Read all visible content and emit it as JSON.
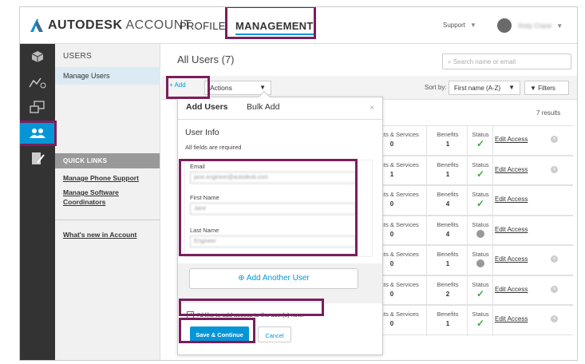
{
  "header": {
    "brand": "AUTODESK",
    "brand_suffix": "ACCOUNT",
    "nav_profile": "PROFILE",
    "nav_management": "MANAGEMENT",
    "support": "Support",
    "user_name": "Andy Crane"
  },
  "subnav": {
    "heading": "USERS",
    "manage_users": "Manage Users",
    "quick_links": "QUICK LINKS",
    "phone_support": "Manage Phone Support",
    "software_coordinators": "Manage Software Coordinators",
    "whats_new": "What's new in Account"
  },
  "main": {
    "title": "All Users (7)",
    "search_placeholder": "Search name or email",
    "add": "+ Add",
    "actions": "Actions",
    "sort_label": "Sort by:",
    "sort_value": "First name (A-Z)",
    "filters": "Filters",
    "results": "7 results"
  },
  "table": {
    "rows": [
      {
        "products_label": "Products & Services",
        "products": "0",
        "benefits_label": "Benefits",
        "benefits": "1",
        "status_label": "Status",
        "status": "active",
        "edit": "Edit Access",
        "removable": true
      },
      {
        "products_label": "Products & Services",
        "products": "1",
        "benefits_label": "Benefits",
        "benefits": "1",
        "status_label": "Status",
        "status": "active",
        "edit": "Edit Access",
        "removable": true
      },
      {
        "products_label": "Products & Services",
        "products": "0",
        "benefits_label": "Benefits",
        "benefits": "4",
        "status_label": "Status",
        "status": "active",
        "edit": "Edit Access",
        "removable": false
      },
      {
        "products_label": "Products & Services",
        "products": "0",
        "benefits_label": "Benefits",
        "benefits": "4",
        "status_label": "Status",
        "status": "pending",
        "edit": "Edit Access",
        "removable": false
      },
      {
        "products_label": "Products & Services",
        "products": "0",
        "benefits_label": "Benefits",
        "benefits": "1",
        "status_label": "Status",
        "status": "pending",
        "edit": "Edit Access",
        "removable": true
      },
      {
        "products_label": "Products & Services",
        "products": "0",
        "benefits_label": "Benefits",
        "benefits": "2",
        "status_label": "Status",
        "status": "active",
        "edit": "Edit Access",
        "removable": true
      },
      {
        "products_label": "Products & Services",
        "products": "0",
        "benefits_label": "Benefits",
        "benefits": "1",
        "status_label": "Status",
        "status": "active",
        "edit": "Edit Access",
        "removable": true
      }
    ]
  },
  "modal": {
    "tab_add_users": "Add Users",
    "tab_bulk_add": "Bulk Add",
    "close": "×",
    "section_title": "User Info",
    "required_note": "All fields are required",
    "email_label": "Email",
    "email_value": "jane.engineer@autodesk.com",
    "first_name_label": "First Name",
    "first_name_value": "Jane",
    "last_name_label": "Last Name",
    "last_name_value": "Engineer",
    "add_another": "Add Another User",
    "checkbox_label": "I'd like to add access to the user(s) now.",
    "save": "Save & Continue",
    "cancel": "Cancel"
  },
  "colors": {
    "accent": "#0696d7",
    "highlight": "#7a1f5c",
    "success": "#3ea83e"
  }
}
